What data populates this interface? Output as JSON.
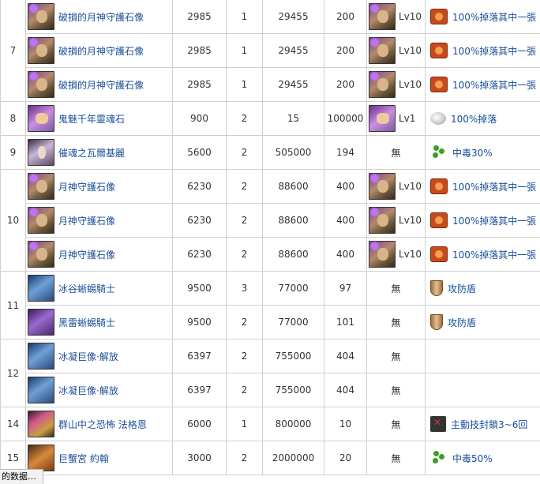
{
  "rows": [
    {
      "stage": "7",
      "name": "破損的月神守護石像",
      "cost": "2985",
      "lvl": "1",
      "exp": "29455",
      "pct": "200",
      "evo_lvl": "Lv10",
      "drop": "100%掉落其中一張"
    },
    {
      "stage": "",
      "name": "破損的月神守護石像",
      "cost": "2985",
      "lvl": "1",
      "exp": "29455",
      "pct": "200",
      "evo_lvl": "Lv10",
      "drop": "100%掉落其中一張"
    },
    {
      "stage": "",
      "name": "破損的月神守護石像",
      "cost": "2985",
      "lvl": "1",
      "exp": "29455",
      "pct": "200",
      "evo_lvl": "Lv10",
      "drop": "100%掉落其中一張"
    },
    {
      "stage": "8",
      "name": "鬼魅千年靈魂石",
      "cost": "900",
      "lvl": "2",
      "exp": "15",
      "pct": "100000",
      "evo_lvl": "Lv1",
      "drop": "100%掉落"
    },
    {
      "stage": "9",
      "name": "催魂之瓦爾基麗",
      "cost": "5600",
      "lvl": "2",
      "exp": "505000",
      "pct": "194",
      "evo_none": "無",
      "drop": "中毒30%"
    },
    {
      "stage": "10",
      "name": "月神守護石像",
      "cost": "6230",
      "lvl": "2",
      "exp": "88600",
      "pct": "400",
      "evo_lvl": "Lv10",
      "drop": "100%掉落其中一張"
    },
    {
      "stage": "",
      "name": "月神守護石像",
      "cost": "6230",
      "lvl": "2",
      "exp": "88600",
      "pct": "400",
      "evo_lvl": "Lv10",
      "drop": "100%掉落其中一張"
    },
    {
      "stage": "",
      "name": "月神守護石像",
      "cost": "6230",
      "lvl": "2",
      "exp": "88600",
      "pct": "400",
      "evo_lvl": "Lv10",
      "drop": "100%掉落其中一張"
    },
    {
      "stage": "11",
      "name": "冰谷蜥蜴騎士",
      "cost": "9500",
      "lvl": "3",
      "exp": "77000",
      "pct": "97",
      "evo_none": "無",
      "drop": "攻防盾"
    },
    {
      "stage": "",
      "name": "黑雷蜥蜴騎士",
      "cost": "9500",
      "lvl": "2",
      "exp": "77000",
      "pct": "101",
      "evo_none": "無",
      "drop": "攻防盾"
    },
    {
      "stage": "12",
      "name": "冰凝巨像·解放",
      "cost": "6397",
      "lvl": "2",
      "exp": "755000",
      "pct": "404",
      "evo_none": "無",
      "drop": ""
    },
    {
      "stage": "",
      "name": "冰凝巨像·解放",
      "cost": "6397",
      "lvl": "2",
      "exp": "755000",
      "pct": "404",
      "evo_none": "無",
      "drop": ""
    },
    {
      "stage": "14",
      "name": "群山中之恐怖 法格恩",
      "cost": "6000",
      "lvl": "1",
      "exp": "800000",
      "pct": "10",
      "evo_none": "無",
      "drop": "主動技封鎖3~6回"
    },
    {
      "stage": "15",
      "name": "巨蟹宮 約翰",
      "cost": "3000",
      "lvl": "2",
      "exp": "2000000",
      "pct": "20",
      "evo_none": "無",
      "drop": "中毒50%"
    }
  ],
  "icons": {
    "portraits": [
      "statue-portrait",
      "statue-portrait",
      "statue-portrait",
      "ghost-portrait",
      "woman-portrait",
      "statue-portrait",
      "statue-portrait",
      "statue-portrait",
      "blue-knight-portrait",
      "purple-knight-portrait",
      "ice-golem-portrait",
      "ice-golem-portrait",
      "gold-beast-portrait",
      "crab-portrait"
    ],
    "drops": [
      "card-icon",
      "card-icon",
      "card-icon",
      "stone-icon",
      "poison-icon",
      "card-icon",
      "card-icon",
      "card-icon",
      "shield-icon",
      "shield-icon",
      "",
      "",
      "act-seal-icon",
      "poison-icon"
    ]
  },
  "status_bar": {
    "text": "的数据…"
  },
  "colors": {
    "link": "#1a4f99",
    "border": "#d0d0d0"
  }
}
